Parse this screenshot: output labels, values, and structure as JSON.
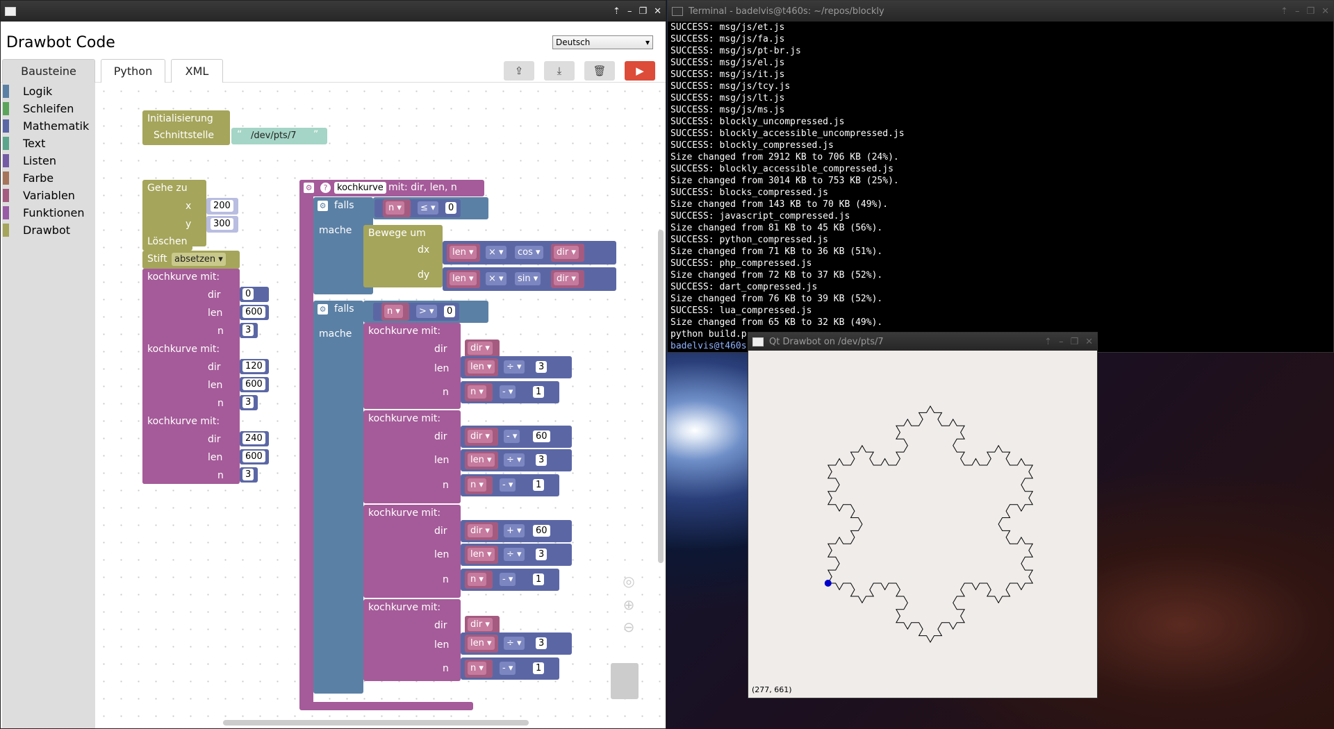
{
  "blockly_window": {
    "title": "Drawbot Code",
    "language": "Deutsch",
    "tabs": [
      {
        "label": "Bausteine",
        "active": true
      },
      {
        "label": "Python",
        "active": false
      },
      {
        "label": "XML",
        "active": false
      }
    ],
    "toolbar": {
      "buttons": [
        "upload-icon",
        "download-icon",
        "trash-icon",
        "run-icon"
      ]
    },
    "toolbox": [
      {
        "label": "Logik",
        "color": "#5b80a5"
      },
      {
        "label": "Schleifen",
        "color": "#5ba55b"
      },
      {
        "label": "Mathematik",
        "color": "#5b67a5"
      },
      {
        "label": "Text",
        "color": "#5ba58c"
      },
      {
        "label": "Listen",
        "color": "#745ba5"
      },
      {
        "label": "Farbe",
        "color": "#a5745b"
      },
      {
        "label": "Variablen",
        "color": "#a55b80"
      },
      {
        "label": "Funktionen",
        "color": "#995ba5"
      },
      {
        "label": "Drawbot",
        "color": "#a5a55b"
      }
    ],
    "blocks": {
      "init_label": "Initialisierung",
      "iface_label": "Schnittstelle",
      "iface_value": "/dev/pts/7",
      "goto_label": "Gehe zu",
      "x_label": "x",
      "x_value": "200",
      "y_label": "y",
      "y_value": "300",
      "clear_label": "Löschen",
      "pen_label": "Stift",
      "pen_value": "absetzen",
      "call_label": "kochkurve  mit:",
      "dir": "dir",
      "len": "len",
      "n": "n",
      "call1": {
        "dir": "0",
        "len": "600",
        "n": "3"
      },
      "call2": {
        "dir": "120",
        "len": "600",
        "n": "3"
      },
      "call3": {
        "dir": "240",
        "len": "600",
        "n": "3"
      },
      "def_name": "kochkurve",
      "def_params": "mit: dir, len, n",
      "if_label": "falls",
      "do_label": "mache",
      "move_label": "Bewege um",
      "dx": "dx",
      "dy": "dy",
      "times": "×",
      "cos": "cos",
      "sin": "sin",
      "le": "≤",
      "gt": ">",
      "zero": "0",
      "div": "÷",
      "minus": "-",
      "plus": "+",
      "three": "3",
      "one": "1",
      "sixty": "60"
    }
  },
  "terminal": {
    "title": "Terminal - badelvis@t460s: ~/repos/blockly",
    "lines": [
      "SUCCESS: msg/js/et.js",
      "SUCCESS: msg/js/fa.js",
      "SUCCESS: msg/js/pt-br.js",
      "SUCCESS: msg/js/el.js",
      "SUCCESS: msg/js/it.js",
      "SUCCESS: msg/js/tcy.js",
      "SUCCESS: msg/js/lt.js",
      "SUCCESS: msg/js/ms.js",
      "SUCCESS: blockly_uncompressed.js",
      "SUCCESS: blockly_accessible_uncompressed.js",
      "SUCCESS: blockly_compressed.js",
      "Size changed from 2912 KB to 706 KB (24%).",
      "SUCCESS: blockly_accessible_compressed.js",
      "Size changed from 3014 KB to 753 KB (25%).",
      "SUCCESS: blocks_compressed.js",
      "Size changed from 143 KB to 70 KB (49%).",
      "SUCCESS: javascript_compressed.js",
      "Size changed from 81 KB to 45 KB (56%).",
      "SUCCESS: python_compressed.js",
      "Size changed from 71 KB to 36 KB (51%).",
      "SUCCESS: php_compressed.js",
      "Size changed from 72 KB to 37 KB (52%).",
      "SUCCESS: dart_compressed.js",
      "Size changed from 76 KB to 39 KB (52%).",
      "SUCCESS: lua_compressed.js",
      "Size changed from 65 KB to 32 KB (49%).",
      "python build.p"
    ],
    "prompt": "badelvis@t460s"
  },
  "qt_window": {
    "title": "Qt Drawbot on /dev/pts/7",
    "coordinates": "(277, 661)"
  }
}
